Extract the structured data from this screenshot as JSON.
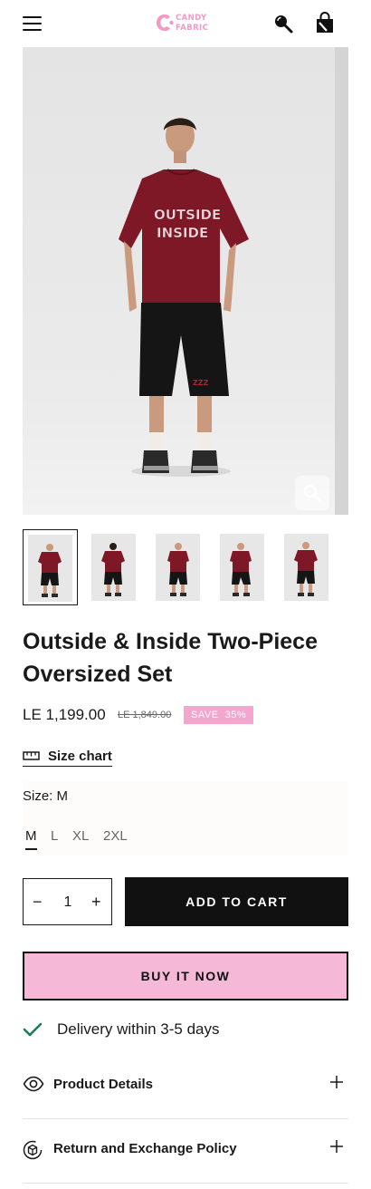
{
  "header": {
    "menu_icon": "hamburger-menu-icon",
    "logo": {
      "line1": "CANDY",
      "line2": "FABRIC"
    },
    "search_icon": "search-icon",
    "cart_icon": "shopping-bag-icon"
  },
  "gallery": {
    "zoom_icon": "magnify-icon",
    "thumbnails": [
      "front",
      "back",
      "front-2",
      "side",
      "front-3"
    ],
    "active_thumbnail": 0
  },
  "product": {
    "title": "Outside & Inside Two-Piece Oversized Set",
    "price": "LE 1,199.00",
    "compare_price": "LE 1,849.00",
    "save_label": "SAVE",
    "save_percent": "35%"
  },
  "size_chart": {
    "label": "Size chart",
    "icon": "ruler-icon"
  },
  "size": {
    "label": "Size: M",
    "options": [
      "M",
      "L",
      "XL",
      "2XL"
    ],
    "selected": "M"
  },
  "quantity": {
    "minus": "−",
    "value": "1",
    "plus": "+"
  },
  "buttons": {
    "add_to_cart": "ADD TO CART",
    "buy_now": "BUY IT NOW"
  },
  "delivery": {
    "icon": "checkmark-icon",
    "text": "Delivery within 3-5 days"
  },
  "accordions": [
    {
      "label": "Product Details",
      "icon": "eye-icon"
    },
    {
      "label": "Return and Exchange Policy",
      "icon": "return-box-icon"
    }
  ],
  "colors": {
    "brand_pink": "#f299c6",
    "badge_pink": "#f4a6cf",
    "buy_now_bg": "#f5b8d6",
    "cart_bg": "#111111",
    "check_green": "#1e7a5c"
  }
}
